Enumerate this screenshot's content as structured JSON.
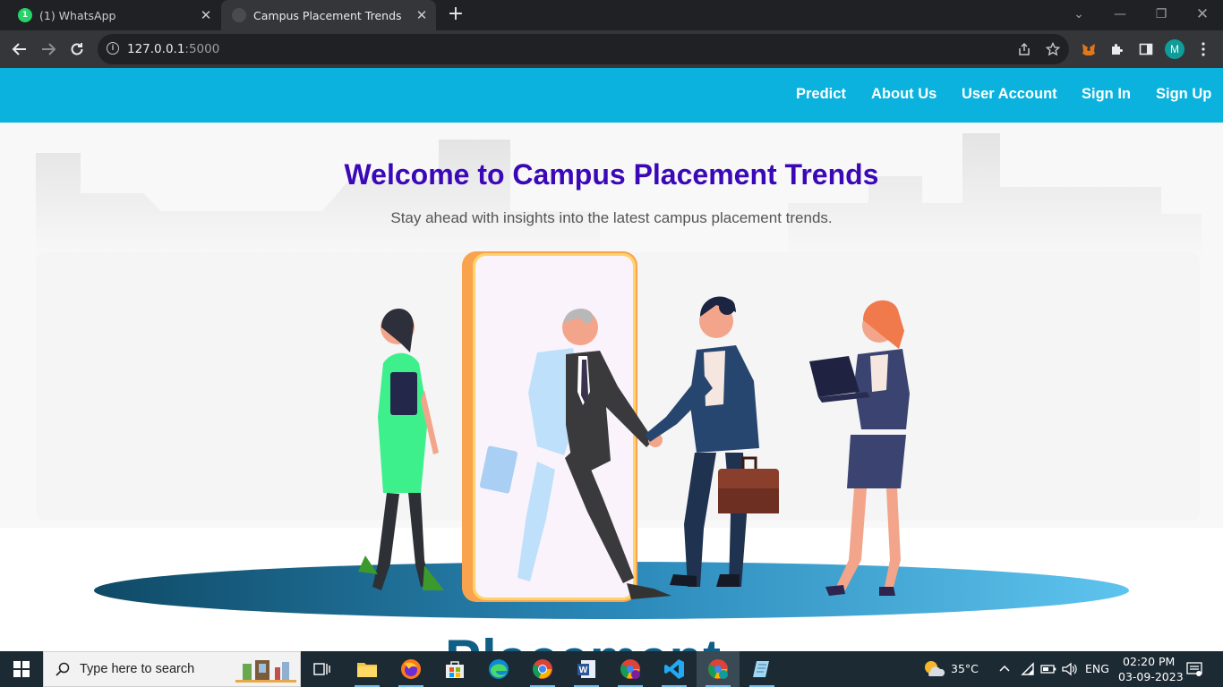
{
  "browser": {
    "tabs": [
      {
        "title": "(1) WhatsApp",
        "badge": "1",
        "active": false
      },
      {
        "title": "Campus Placement Trends",
        "active": true
      }
    ],
    "new_tab": "+",
    "url_host": "127.0.0.1",
    "url_port": ":5000",
    "profile_initial": "M"
  },
  "site": {
    "nav": [
      "Predict",
      "About Us",
      "User Account",
      "Sign In",
      "Sign Up"
    ],
    "title": "Welcome to Campus Placement Trends",
    "subtitle": "Stay ahead with insights into the latest campus placement trends.",
    "cutoff_word": "Placement"
  },
  "taskbar": {
    "search_placeholder": "Type here to search",
    "temperature": "35°C",
    "language": "ENG",
    "time": "02:20 PM",
    "date": "03-09-2023",
    "pinned": [
      "task-view",
      "file-explorer",
      "firefox",
      "microsoft-store",
      "edge",
      "chrome",
      "word",
      "chrome-profile",
      "vs-code",
      "chrome-active",
      "notepad"
    ]
  },
  "colors": {
    "navbar": "#0bb2de",
    "heading": "#3b08b8",
    "taskbar": "#1c2a33"
  }
}
